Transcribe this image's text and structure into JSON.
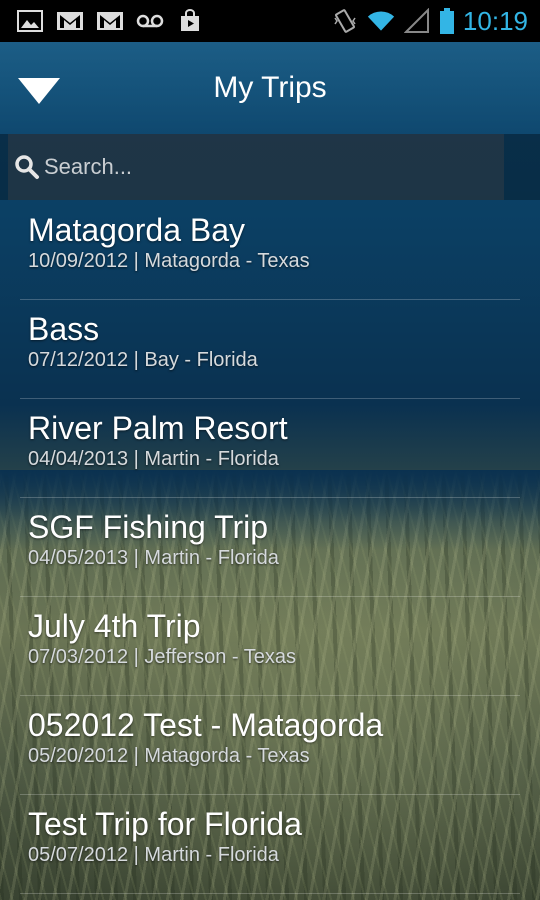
{
  "status_bar": {
    "time": "10:19",
    "icons": [
      "gallery-icon",
      "gmail-icon",
      "gmail-icon",
      "voicemail-icon",
      "store-icon",
      "vibrate-icon",
      "wifi-icon",
      "signal-icon",
      "battery-icon"
    ]
  },
  "header": {
    "title": "My Trips",
    "menu_icon": "triangle-down-icon"
  },
  "search": {
    "placeholder": "Search..."
  },
  "trips": [
    {
      "name": "Matagorda Bay",
      "details": "10/09/2012 | Matagorda - Texas"
    },
    {
      "name": "Bass",
      "details": "07/12/2012 | Bay - Florida"
    },
    {
      "name": "River Palm Resort",
      "details": "04/04/2013 | Martin - Florida"
    },
    {
      "name": "SGF Fishing Trip",
      "details": "04/05/2013 | Martin - Florida"
    },
    {
      "name": "July 4th Trip",
      "details": "07/03/2012 | Jefferson - Texas"
    },
    {
      "name": "052012 Test - Matagorda",
      "details": "05/20/2012 | Matagorda - Texas"
    },
    {
      "name": "Test Trip for Florida",
      "details": "05/07/2012 | Martin - Florida"
    }
  ],
  "colors": {
    "accent": "#33b5e5",
    "header_text": "#ffffff"
  }
}
